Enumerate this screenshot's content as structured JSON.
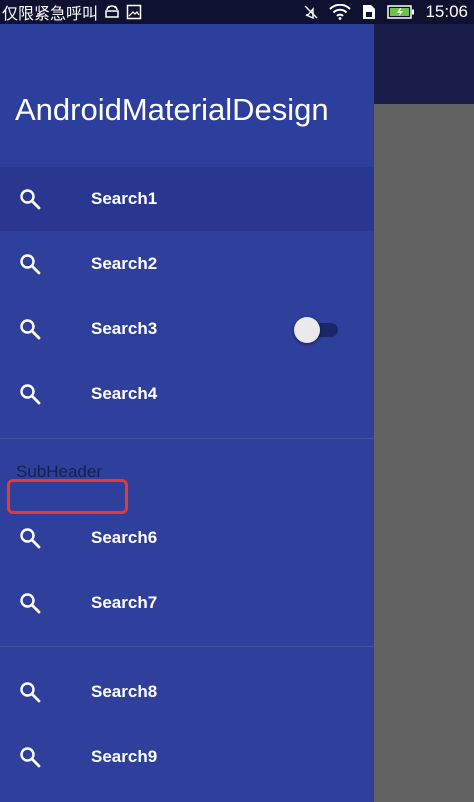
{
  "status_bar": {
    "carrier": "仅限紧急呼叫",
    "time": "15:06",
    "icons": [
      "android-icon",
      "image-icon",
      "mute-icon",
      "wifi-icon",
      "sim-icon",
      "battery-charging-icon"
    ]
  },
  "drawer": {
    "title": "AndroidMaterialDesign",
    "items_group1": [
      {
        "label": "Search1",
        "icon": "search-icon",
        "active": true
      },
      {
        "label": "Search2",
        "icon": "search-icon"
      },
      {
        "label": "Search3",
        "icon": "search-icon",
        "has_switch": true,
        "switch_on": false
      },
      {
        "label": "Search4",
        "icon": "search-icon"
      }
    ],
    "subheader": "SubHeader",
    "items_group2": [
      {
        "label": "Search6",
        "icon": "search-icon"
      },
      {
        "label": "Search7",
        "icon": "search-icon"
      }
    ],
    "items_group3": [
      {
        "label": "Search8",
        "icon": "search-icon"
      },
      {
        "label": "Search9",
        "icon": "search-icon"
      }
    ]
  },
  "colors": {
    "drawer_bg": "#2f3f9c",
    "active_item_bg": "#2a3790",
    "highlight": "#e53935",
    "scrim": "#626262"
  }
}
